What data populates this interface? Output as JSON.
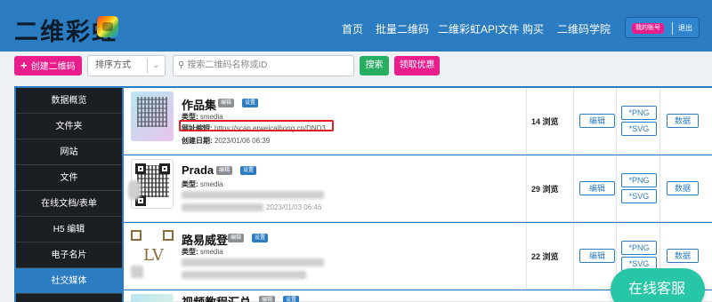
{
  "header": {
    "brand": "二维彩虹",
    "nav": [
      "首页",
      "批量二维码",
      "二维彩虹API文件",
      "购买",
      "二维码学院"
    ],
    "account": "我的账号",
    "logout": "退出"
  },
  "toolbar": {
    "create_label": "创建二维码",
    "sort_placeholder": "排序方式",
    "search_placeholder": "搜索二维码名称或ID",
    "search_button": "搜索",
    "coupon_button": "领取优惠"
  },
  "sidebar": {
    "items": [
      {
        "label": "数据概览"
      },
      {
        "label": "文件夹"
      },
      {
        "label": "网站"
      },
      {
        "label": "文件"
      },
      {
        "label": "在线文档/表单"
      },
      {
        "label": "H5 编辑"
      },
      {
        "label": "电子名片"
      },
      {
        "label": "社交媒体",
        "active": true
      }
    ]
  },
  "common": {
    "edit_tag": "编辑",
    "settings_tag": "设置",
    "edit_button": "编辑",
    "png_button": "*PNG",
    "svg_button": "*SVG",
    "data_button": "数据"
  },
  "rows": [
    {
      "title": "作品集",
      "type_label": "类型:",
      "type_value": "smedia",
      "url_label": "网址缩短:",
      "url_value": "https://scan.erweicaihong.cn/DND3",
      "created_label": "创建日期:",
      "created_value": "2023/01/06 06:39",
      "views": "14 浏览"
    },
    {
      "title": "Prada",
      "type_label": "类型:",
      "type_value": "smedia",
      "created_value": "2023/01/03 06:46",
      "views": "29 浏览"
    },
    {
      "title": "路易威登",
      "type_label": "类型:",
      "type_value": "smedia",
      "views": "22 浏览"
    },
    {
      "title": "视频教程汇总"
    }
  ],
  "online_service": "在线客服",
  "colors": {
    "header_blue": "#2b7cc0",
    "pink": "#e91e8c",
    "green": "#27ae60",
    "sidebar": "#1b1f23",
    "highlight_red": "#e02020",
    "service_teal": "#26c6a6"
  }
}
